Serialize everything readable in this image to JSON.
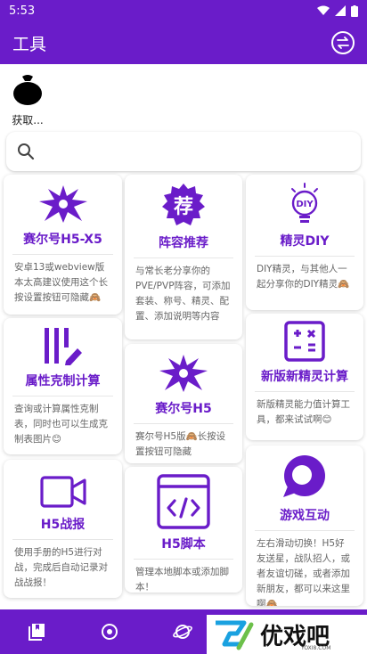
{
  "status_bar": {
    "time": "5:53"
  },
  "header": {
    "title": "工具"
  },
  "avatar": {
    "label": "获取..."
  },
  "search": {
    "placeholder": ""
  },
  "cards": [
    {
      "title": "赛尔号H5-X5",
      "desc": "安卓13或webview版本太高建议使用这个长按设置按钮可隐藏🙈"
    },
    {
      "title": "阵容推荐",
      "desc": "与常长老分享你的PVE/PVP阵容，可添加套装、称号、精灵、配置、添加说明等内容",
      "icon_text": "荐"
    },
    {
      "title": "精灵DIY",
      "desc": "DIY精灵，与其他人一起分享你的DIY精灵🙈",
      "icon_text": "DIY"
    },
    {
      "title": "属性克制计算",
      "desc": "查询或计算属性克制表，同时也可以生成克制表图片😊"
    },
    {
      "title": "赛尔号H5",
      "desc": "赛尔号H5版🙈长按设置按钮可隐藏"
    },
    {
      "title": "新版新精灵计算",
      "desc": "新版精灵能力值计算工具，都来试试啊😊"
    },
    {
      "title": "H5战报",
      "desc": "使用手册的H5进行对战，完成后自动记录对战战报！"
    },
    {
      "title": "H5脚本",
      "desc": "管理本地脚本或添加脚本！"
    },
    {
      "title": "游戏互动",
      "desc": "左右滑动切换！H5好友送星，战队招人，或者友谊切磋，或者添加新朋友，都可以来这里啊🙈"
    }
  ],
  "watermark": {
    "text": "优戏吧",
    "url": "YOXI8.COM"
  },
  "colors": {
    "primary": "#6a1cc9",
    "card_title": "#6a1cc9"
  },
  "icons": [
    "avatar-bag-icon",
    "swap-icon",
    "search-icon",
    "spiky-creature-icon",
    "recommend-badge-icon",
    "diy-bulb-icon",
    "attribute-chart-icon",
    "calculator-icon",
    "video-camera-icon",
    "code-window-icon",
    "chat-bubble-icon",
    "book-icon",
    "camera-lens-icon",
    "planet-icon"
  ]
}
